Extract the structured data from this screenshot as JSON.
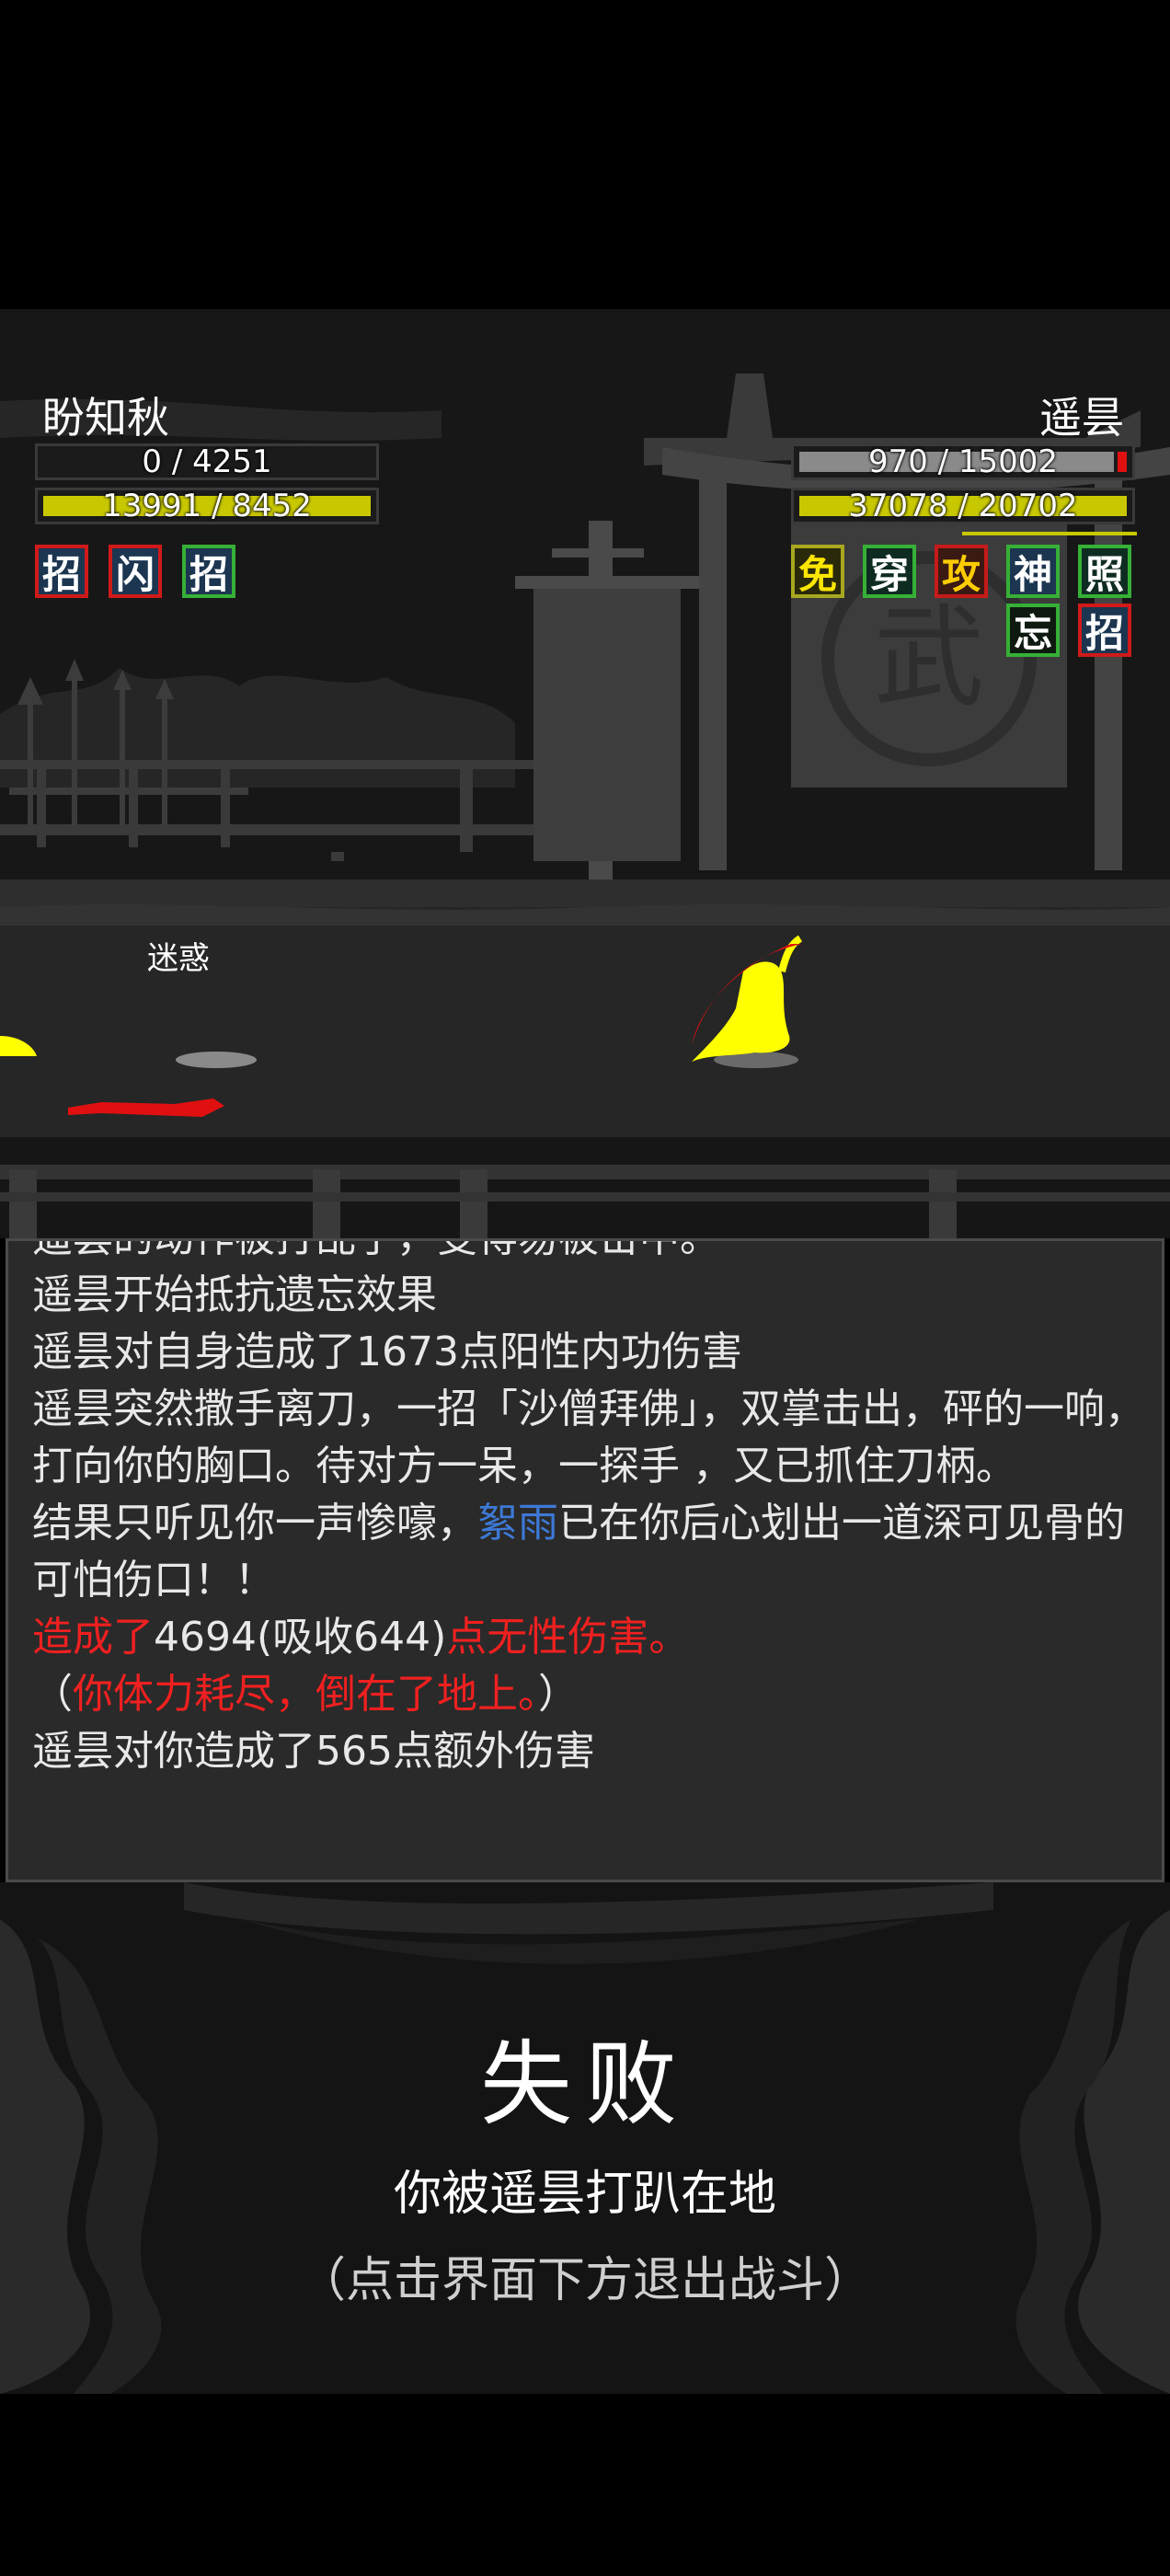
{
  "player": {
    "name": "盼知秋",
    "hp_text": "0 / 4251",
    "hp_fraction": 0.0,
    "energy_text": "13991 / 8452",
    "energy_fraction": 1.0,
    "buffs": [
      "招",
      "闪",
      "招"
    ]
  },
  "enemy": {
    "name": "遥昙",
    "hp_text": "970 / 15002",
    "hp_fraction": 0.065,
    "energy_text": "37078 / 20702",
    "energy_fraction": 1.0,
    "buffs_row1": [
      "免",
      "穿",
      "攻",
      "神",
      "照"
    ],
    "buffs_row2": [
      "忘",
      "招"
    ]
  },
  "scene": {
    "status_label": "迷惑",
    "banner_glyph": "武"
  },
  "log": {
    "cut_line": "遥昙的动作被打乱了，变得易被击中。",
    "line1": "遥昙开始抵抗遗忘效果",
    "line2": "遥昙对自身造成了1673点阳性内功伤害",
    "line3": "遥昙突然撒手离刀，一招「沙僧拜佛」，双掌击出，砰的一响，打向你的胸口。待对方一呆，一探手 ，又已抓住刀柄。",
    "line4_a": "结果只听见你一声惨嚎，",
    "line4_weapon": "絮雨",
    "line4_b": "已在你后心划出一道深可见骨的可怕伤口！！",
    "line5_a": "造成了",
    "line5_b": "4694(吸收644)",
    "line5_c": "点无性伤害。",
    "line6_a": "（",
    "line6_b": "你体力耗尽，倒在了地上。",
    "line6_c": "）",
    "line7": "遥昙对你造成了565点额外伤害"
  },
  "result": {
    "title": "失败",
    "subtitle": "你被遥昙打趴在地",
    "hint": "（点击界面下方退出战斗）"
  },
  "colors": {
    "hp_fill": "#8a8a8a",
    "hp_low": "#e01010",
    "energy_fill": "#c8c800",
    "damage_red": "#f02020",
    "weapon_blue": "#3d79d6",
    "character_yellow": "#ffff00"
  }
}
